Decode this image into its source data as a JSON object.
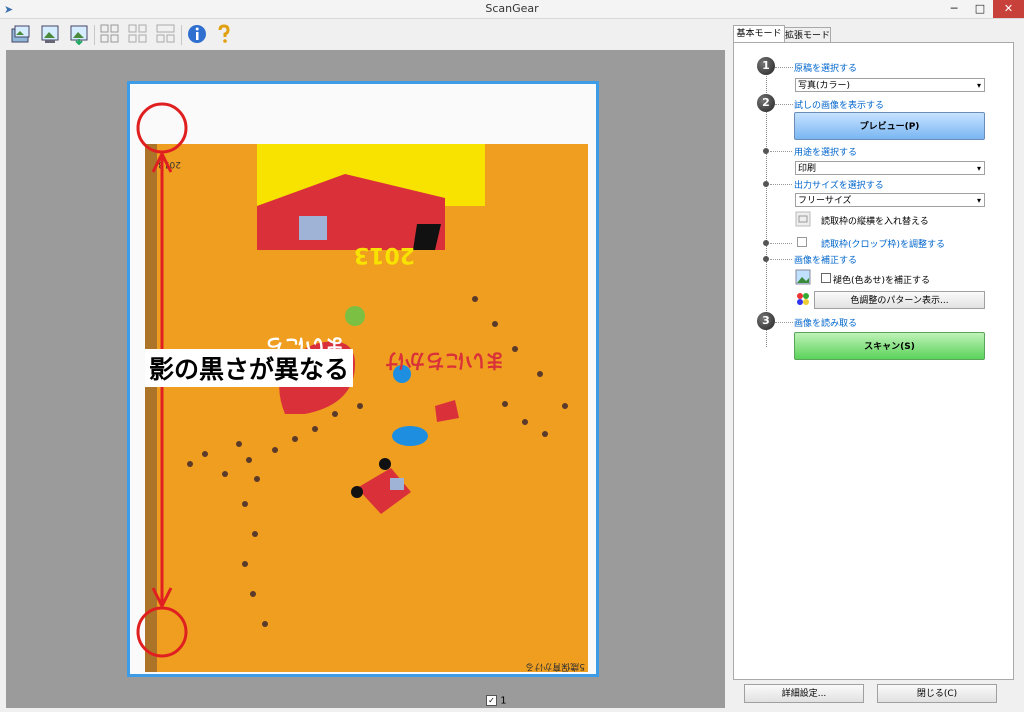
{
  "window": {
    "title": "ScanGear",
    "minimize": "─",
    "maximize": "□",
    "close": "✕"
  },
  "toolbar": {
    "icons": [
      "scan-multi-icon",
      "save-image-icon",
      "save-all-icon",
      "select-all-icon",
      "multi-crop-icon",
      "crop-icon",
      "info-icon",
      "help-icon"
    ]
  },
  "preview": {
    "page_number": "1",
    "callout": "影の黒さが異なる"
  },
  "tabs": {
    "basic": "基本モード",
    "advanced": "拡張モード"
  },
  "steps": {
    "s1_num": "1",
    "s2_num": "2",
    "s3_num": "3",
    "select_source": "原稿を選択する",
    "source_value": "写真(カラー)",
    "show_preview": "試しの画像を表示する",
    "preview_button": "プレビュー(P)",
    "select_purpose": "用途を選択する",
    "purpose_value": "印刷",
    "select_output_size": "出力サイズを選択する",
    "output_size_value": "フリーサイズ",
    "swap_orientation": "読取枠の縦横を入れ替える",
    "adjust_crop": "読取枠(クロップ枠)を調整する",
    "correct_image": "画像を補正する",
    "fade_correction": "褪色(色あせ)を補正する",
    "color_pattern_button": "色調整のパターン表示...",
    "scan_image": "画像を読み取る",
    "scan_button": "スキャン(S)"
  },
  "footer": {
    "details_button": "詳細設定...",
    "close_button": "閉じる(C)"
  },
  "colors": {
    "accent": "#3c9ce8",
    "link": "#0066cc",
    "orange": "#ef9e20",
    "red_mark": "#e02020"
  }
}
